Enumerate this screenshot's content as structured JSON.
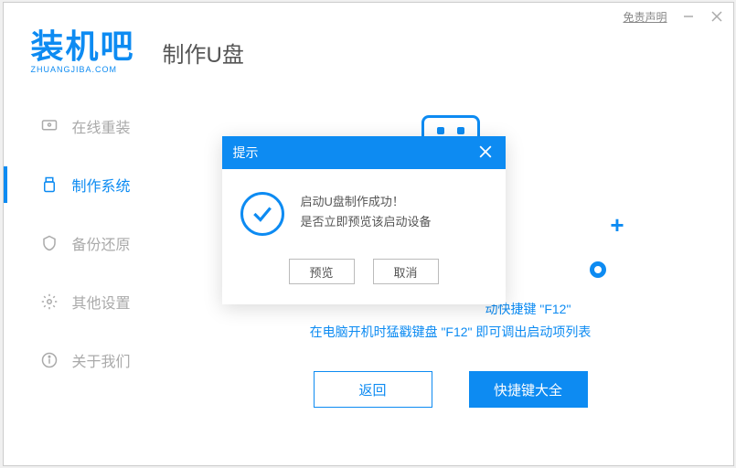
{
  "titlebar": {
    "disclaimer": "免责声明"
  },
  "logo": {
    "main": "装机吧",
    "sub": "ZHUANGJIBA.COM"
  },
  "page_title": "制作U盘",
  "sidebar": {
    "items": [
      {
        "label": "在线重装"
      },
      {
        "label": "制作系统"
      },
      {
        "label": "备份还原"
      },
      {
        "label": "其他设置"
      },
      {
        "label": "关于我们"
      }
    ]
  },
  "main": {
    "tip1_partial": "动快捷键 \"F12\"",
    "tip2": "在电脑开机时猛戳键盘 \"F12\" 即可调出启动项列表",
    "back_btn": "返回",
    "shortcuts_btn": "快捷键大全"
  },
  "modal": {
    "title": "提示",
    "line1": "启动U盘制作成功！",
    "line2": "是否立即预览该启动设备",
    "preview_btn": "预览",
    "cancel_btn": "取消"
  }
}
